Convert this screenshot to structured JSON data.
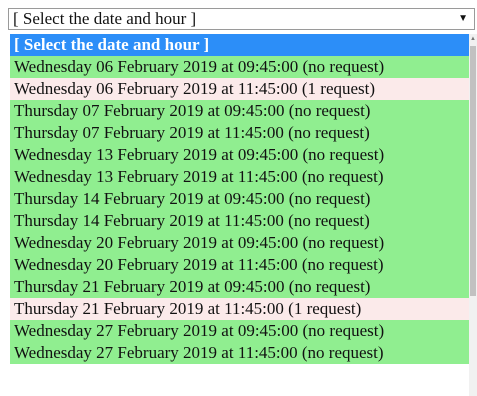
{
  "select": {
    "value": "[ Select the date and hour ]",
    "arrow": "▼"
  },
  "options": [
    {
      "label": "[ Select the date and hour ]",
      "status": "selected"
    },
    {
      "label": "Wednesday 06 February 2019 at 09:45:00 (no request)",
      "status": "green"
    },
    {
      "label": "Wednesday 06 February 2019 at 11:45:00 (1 request)",
      "status": "pink"
    },
    {
      "label": "Thursday 07 February 2019 at 09:45:00 (no request)",
      "status": "green"
    },
    {
      "label": "Thursday 07 February 2019 at 11:45:00 (no request)",
      "status": "green"
    },
    {
      "label": "Wednesday 13 February 2019 at 09:45:00 (no request)",
      "status": "green"
    },
    {
      "label": "Wednesday 13 February 2019 at 11:45:00 (no request)",
      "status": "green"
    },
    {
      "label": "Thursday 14 February 2019 at 09:45:00 (no request)",
      "status": "green"
    },
    {
      "label": "Thursday 14 February 2019 at 11:45:00 (no request)",
      "status": "green"
    },
    {
      "label": "Wednesday 20 February 2019 at 09:45:00 (no request)",
      "status": "green"
    },
    {
      "label": "Wednesday 20 February 2019 at 11:45:00 (no request)",
      "status": "green"
    },
    {
      "label": "Thursday 21 February 2019 at 09:45:00 (no request)",
      "status": "green"
    },
    {
      "label": "Thursday 21 February 2019 at 11:45:00 (1 request)",
      "status": "pink"
    },
    {
      "label": "Wednesday 27 February 2019 at 09:45:00 (no request)",
      "status": "green"
    },
    {
      "label": "Wednesday 27 February 2019 at 11:45:00 (no request)",
      "status": "green"
    }
  ],
  "colors": {
    "selected": "#2c8ef8",
    "available": "#90ee90",
    "requested": "#fbeaea"
  },
  "icons": {
    "dropdown_arrow": "chevron-down-icon",
    "scroll_up": "scroll-up-arrow-icon"
  }
}
